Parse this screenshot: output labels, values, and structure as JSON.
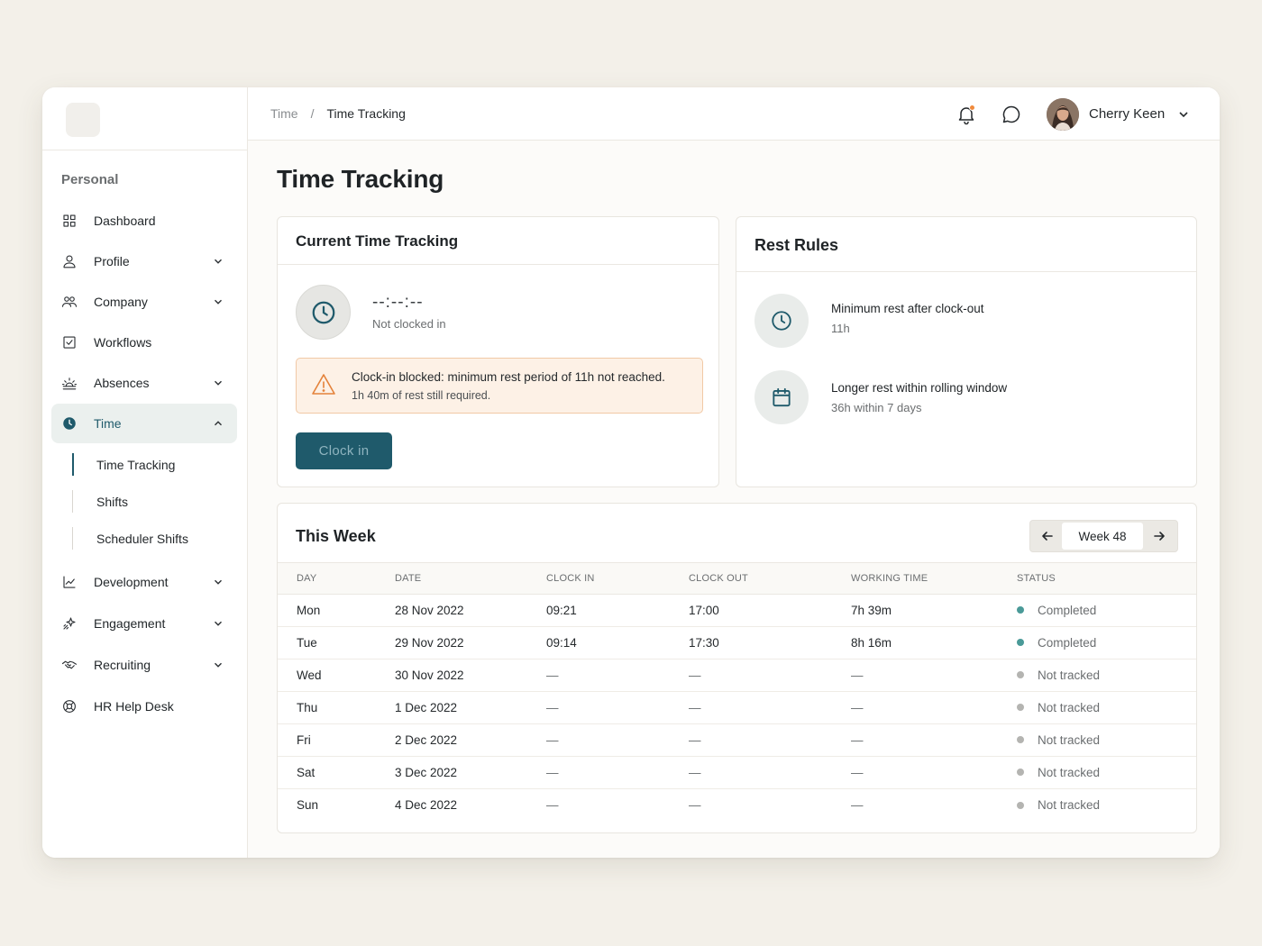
{
  "sidebar": {
    "section_label": "Personal",
    "items": [
      {
        "label": "Dashboard",
        "icon": "grid-icon"
      },
      {
        "label": "Profile",
        "icon": "user-icon"
      },
      {
        "label": "Company",
        "icon": "team-icon"
      },
      {
        "label": "Workflows",
        "icon": "checkbox-icon"
      },
      {
        "label": "Absences",
        "icon": "sunrise-icon"
      },
      {
        "label": "Time",
        "icon": "clock-icon"
      },
      {
        "label": "Development",
        "icon": "chart-line-icon"
      },
      {
        "label": "Engagement",
        "icon": "sparkle-icon"
      },
      {
        "label": "Recruiting",
        "icon": "handshake-icon"
      },
      {
        "label": "HR Help Desk",
        "icon": "lifebuoy-icon"
      }
    ],
    "time_sub_items": [
      "Time Tracking",
      "Shifts",
      "Scheduler Shifts"
    ]
  },
  "header": {
    "breadcrumb": [
      "Time",
      "Time Tracking"
    ],
    "breadcrumb_separator": "/",
    "user_name": "Cherry Keen",
    "notification_dot_color": "#f08a3c"
  },
  "page": {
    "title": "Time Tracking"
  },
  "current_tracking": {
    "title": "Current Time Tracking",
    "timer": "--:--:--",
    "status": "Not clocked in",
    "alert_title": "Clock-in blocked: minimum rest period of 11h not reached.",
    "alert_detail": "1h 40m of rest still required.",
    "button_label": "Clock in"
  },
  "rest_rules": {
    "title": "Rest Rules",
    "rules": [
      {
        "title": "Minimum rest after clock-out",
        "value": "11h",
        "icon": "clock-icon"
      },
      {
        "title": "Longer rest within rolling window",
        "value": "36h within 7 days",
        "icon": "calendar-icon"
      }
    ]
  },
  "this_week": {
    "title": "This Week",
    "week_label": "Week 48",
    "columns": [
      "DAY",
      "DATE",
      "CLOCK IN",
      "CLOCK OUT",
      "WORKING TIME",
      "STATUS"
    ],
    "rows": [
      {
        "day": "Mon",
        "date": "28 Nov 2022",
        "clock_in": "09:21",
        "clock_out": "17:00",
        "working": "7h 39m",
        "status": "Completed"
      },
      {
        "day": "Tue",
        "date": "29 Nov 2022",
        "clock_in": "09:14",
        "clock_out": "17:30",
        "working": "8h 16m",
        "status": "Completed"
      },
      {
        "day": "Wed",
        "date": "30 Nov 2022",
        "clock_in": "—",
        "clock_out": "—",
        "working": "—",
        "status": "Not tracked"
      },
      {
        "day": "Thu",
        "date": "1 Dec 2022",
        "clock_in": "—",
        "clock_out": "—",
        "working": "—",
        "status": "Not tracked"
      },
      {
        "day": "Fri",
        "date": "2 Dec 2022",
        "clock_in": "—",
        "clock_out": "—",
        "working": "—",
        "status": "Not tracked"
      },
      {
        "day": "Sat",
        "date": "3 Dec 2022",
        "clock_in": "—",
        "clock_out": "—",
        "working": "—",
        "status": "Not tracked"
      },
      {
        "day": "Sun",
        "date": "4 Dec 2022",
        "clock_in": "—",
        "clock_out": "—",
        "working": "—",
        "status": "Not tracked"
      }
    ],
    "status_colors": {
      "Completed": "#4a9a98",
      "Not tracked": "#b4b4b1"
    }
  },
  "colors": {
    "accent": "#1f5a6b",
    "alert_bg": "#fdf1e6",
    "alert_icon": "#e4823a"
  }
}
